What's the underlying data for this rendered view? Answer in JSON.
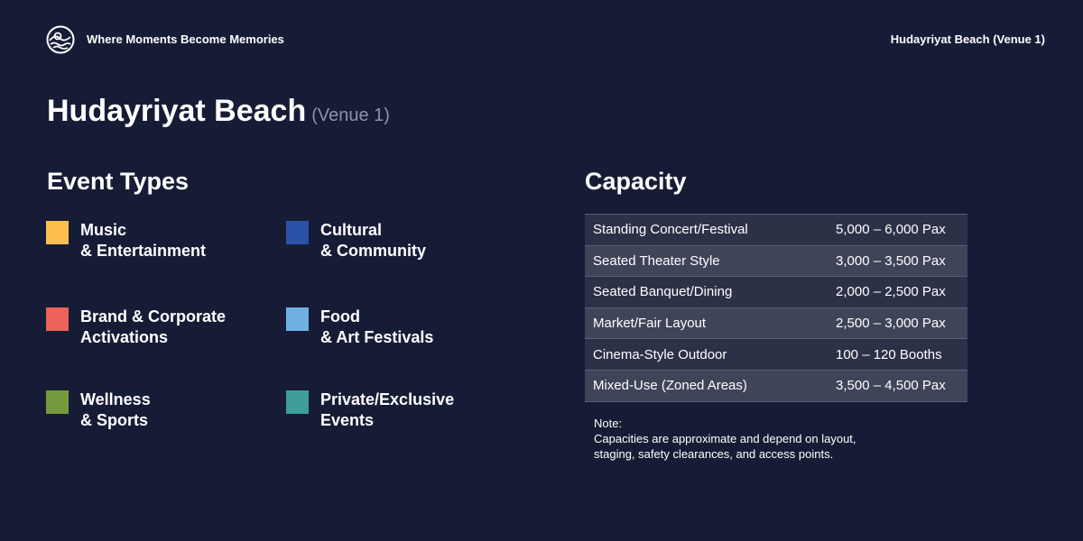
{
  "header": {
    "tagline": "Where Moments Become Memories",
    "venue": "Hudayriyat Beach (Venue 1)"
  },
  "title": {
    "main": "Hudayriyat Beach",
    "sub": "(Venue 1)"
  },
  "event_types": {
    "heading": "Event Types",
    "items": [
      {
        "line1": "Music",
        "line2": "& Entertainment",
        "color": "#fdbf4d"
      },
      {
        "line1": "Cultural",
        "line2": "& Community",
        "color": "#2c52a8"
      },
      {
        "line1": "Brand & Corporate",
        "line2": "Activations",
        "color": "#ec6259"
      },
      {
        "line1": "Food",
        "line2": "& Art Festivals",
        "color": "#6fb1e3"
      },
      {
        "line1": "Wellness",
        "line2": "& Sports",
        "color": "#769b3f"
      },
      {
        "line1": "Private/Exclusive",
        "line2": "Events",
        "color": "#3f9d9a"
      }
    ]
  },
  "capacity": {
    "heading": "Capacity",
    "rows": [
      {
        "label": "Standing Concert/Festival",
        "value": "5,000 – 6,000 Pax"
      },
      {
        "label": "Seated Theater Style",
        "value": "3,000 – 3,500 Pax"
      },
      {
        "label": "Seated Banquet/Dining",
        "value": "2,000 – 2,500 Pax"
      },
      {
        "label": "Market/Fair Layout",
        "value": "2,500 – 3,000 Pax"
      },
      {
        "label": "Cinema-Style Outdoor",
        "value": "100 – 120 Booths"
      },
      {
        "label": "Mixed-Use (Zoned Areas)",
        "value": "3,500 – 4,500 Pax"
      }
    ]
  },
  "note": {
    "label": "Note:",
    "line1": "Capacities are approximate and depend on layout,",
    "line2": "staging, safety clearances, and access points."
  },
  "colors": {
    "background": "#171c36",
    "row_odd": "#2c3148",
    "row_even": "#3f4459"
  },
  "icons": {
    "logo": "sun-over-waves-logo-icon"
  }
}
